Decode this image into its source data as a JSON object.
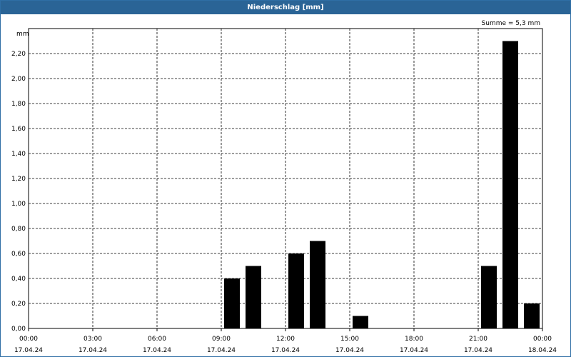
{
  "window": {
    "title": "Niederschlag [mm]"
  },
  "chart_data": {
    "type": "bar",
    "title": "Niederschlag [mm]",
    "sum_label": "Summe = 5,3 mm",
    "ylabel": "mm",
    "ylim": [
      0,
      2.4
    ],
    "y_ticks": [
      "0,00",
      "0,20",
      "0,40",
      "0,60",
      "0,80",
      "1,00",
      "1,20",
      "1,40",
      "1,60",
      "1,80",
      "2,00",
      "2,20"
    ],
    "x_hours_range": [
      0,
      24
    ],
    "x_ticks": [
      {
        "hour": 0,
        "time": "00:00",
        "date": "17.04.24"
      },
      {
        "hour": 3,
        "time": "03:00",
        "date": "17.04.24"
      },
      {
        "hour": 6,
        "time": "06:00",
        "date": "17.04.24"
      },
      {
        "hour": 9,
        "time": "09:00",
        "date": "17.04.24"
      },
      {
        "hour": 12,
        "time": "12:00",
        "date": "17.04.24"
      },
      {
        "hour": 15,
        "time": "15:00",
        "date": "17.04.24"
      },
      {
        "hour": 18,
        "time": "18:00",
        "date": "17.04.24"
      },
      {
        "hour": 21,
        "time": "21:00",
        "date": "17.04.24"
      },
      {
        "hour": 24,
        "time": "00:00",
        "date": "18.04.24"
      }
    ],
    "bars": [
      {
        "hour": 9,
        "value": 0.4
      },
      {
        "hour": 10,
        "value": 0.5
      },
      {
        "hour": 12,
        "value": 0.6
      },
      {
        "hour": 13,
        "value": 0.7
      },
      {
        "hour": 15,
        "value": 0.1
      },
      {
        "hour": 21,
        "value": 0.5
      },
      {
        "hour": 22,
        "value": 2.3
      },
      {
        "hour": 23,
        "value": 0.2
      }
    ],
    "grid": true,
    "bar_color": "#000000"
  }
}
